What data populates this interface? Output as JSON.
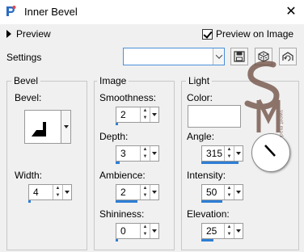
{
  "window": {
    "title": "Inner Bevel",
    "close_glyph": "✕"
  },
  "preview": {
    "label": "Preview",
    "preview_on_image_label": "Preview on Image",
    "preview_on_image_checked": true
  },
  "settings": {
    "label": "Settings",
    "value": ""
  },
  "toolbar": {
    "save_icon": "save-icon",
    "reset_icon": "reset-icon",
    "reset_default_icon": "reset-default-icon"
  },
  "bevel": {
    "group_title": "Bevel",
    "bevel_label": "Bevel:",
    "width_label": "Width:",
    "width_value": "4",
    "width_fraction": 0.06
  },
  "image": {
    "group_title": "Image",
    "smoothness_label": "Smoothness:",
    "smoothness_value": "2",
    "smoothness_fraction": 0.02,
    "depth_label": "Depth:",
    "depth_value": "3",
    "depth_fraction": 0.1,
    "ambience_label": "Ambience:",
    "ambience_value": "2",
    "ambience_fraction": 0.5,
    "shininess_label": "Shininess:",
    "shininess_value": "0",
    "shininess_fraction": 0.0
  },
  "light": {
    "group_title": "Light",
    "color_label": "Color:",
    "color_value": "#ffffff",
    "angle_label": "Angle:",
    "angle_value": "315",
    "angle_fraction": 0.875,
    "intensity_label": "Intensity:",
    "intensity_value": "50",
    "intensity_fraction": 0.5,
    "elevation_label": "Elevation:",
    "elevation_value": "25",
    "elevation_fraction": 0.28
  },
  "watermark": {
    "letters": "SM",
    "small_text": "sweet made"
  },
  "colors": {
    "accent": "#2e7ed6",
    "watermark": "#6b4a3e"
  }
}
